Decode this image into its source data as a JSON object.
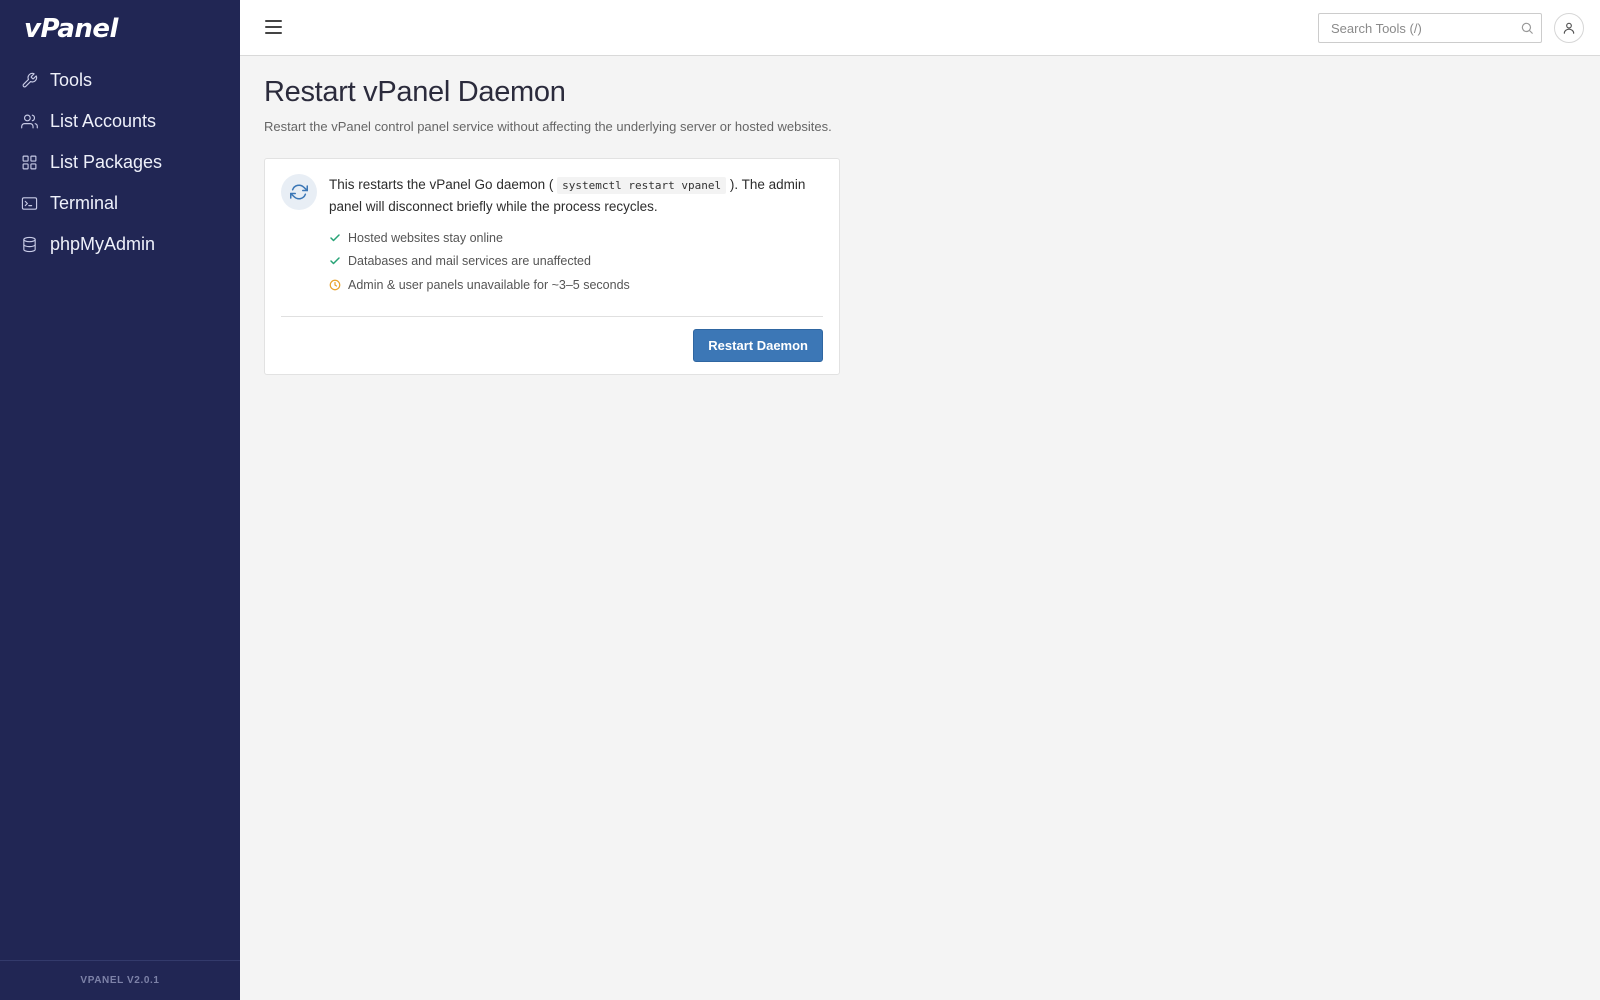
{
  "app": {
    "logo_text": "vPanel",
    "version": "VPANEL V2.0.1"
  },
  "sidebar": {
    "items": [
      {
        "label": "Tools",
        "icon": "wrench-icon"
      },
      {
        "label": "List Accounts",
        "icon": "users-icon"
      },
      {
        "label": "List Packages",
        "icon": "grid-icon"
      },
      {
        "label": "Terminal",
        "icon": "terminal-icon"
      },
      {
        "label": "phpMyAdmin",
        "icon": "database-icon"
      }
    ]
  },
  "topbar": {
    "search_placeholder": "Search Tools (/)",
    "search_value": ""
  },
  "page": {
    "title": "Restart vPanel Daemon",
    "subtitle": "Restart the vPanel control panel service without affecting the underlying server or hosted websites."
  },
  "card": {
    "desc_before": "This restarts the vPanel Go daemon (",
    "command": "systemctl restart vpanel",
    "desc_after": "). The admin panel will disconnect briefly while the process recycles.",
    "bullets": [
      {
        "text": "Hosted websites stay online",
        "icon": "check-icon",
        "color": "#27a376"
      },
      {
        "text": "Databases and mail services are unaffected",
        "icon": "check-icon",
        "color": "#27a376"
      },
      {
        "text": "Admin & user panels unavailable for ~3–5 seconds",
        "icon": "clock-warning-icon",
        "color": "#e8a32c"
      }
    ],
    "button_label": "Restart Daemon"
  },
  "colors": {
    "sidebar_bg": "#212654",
    "accent": "#3c77b6",
    "success": "#27a376",
    "warning": "#e8a32c"
  }
}
